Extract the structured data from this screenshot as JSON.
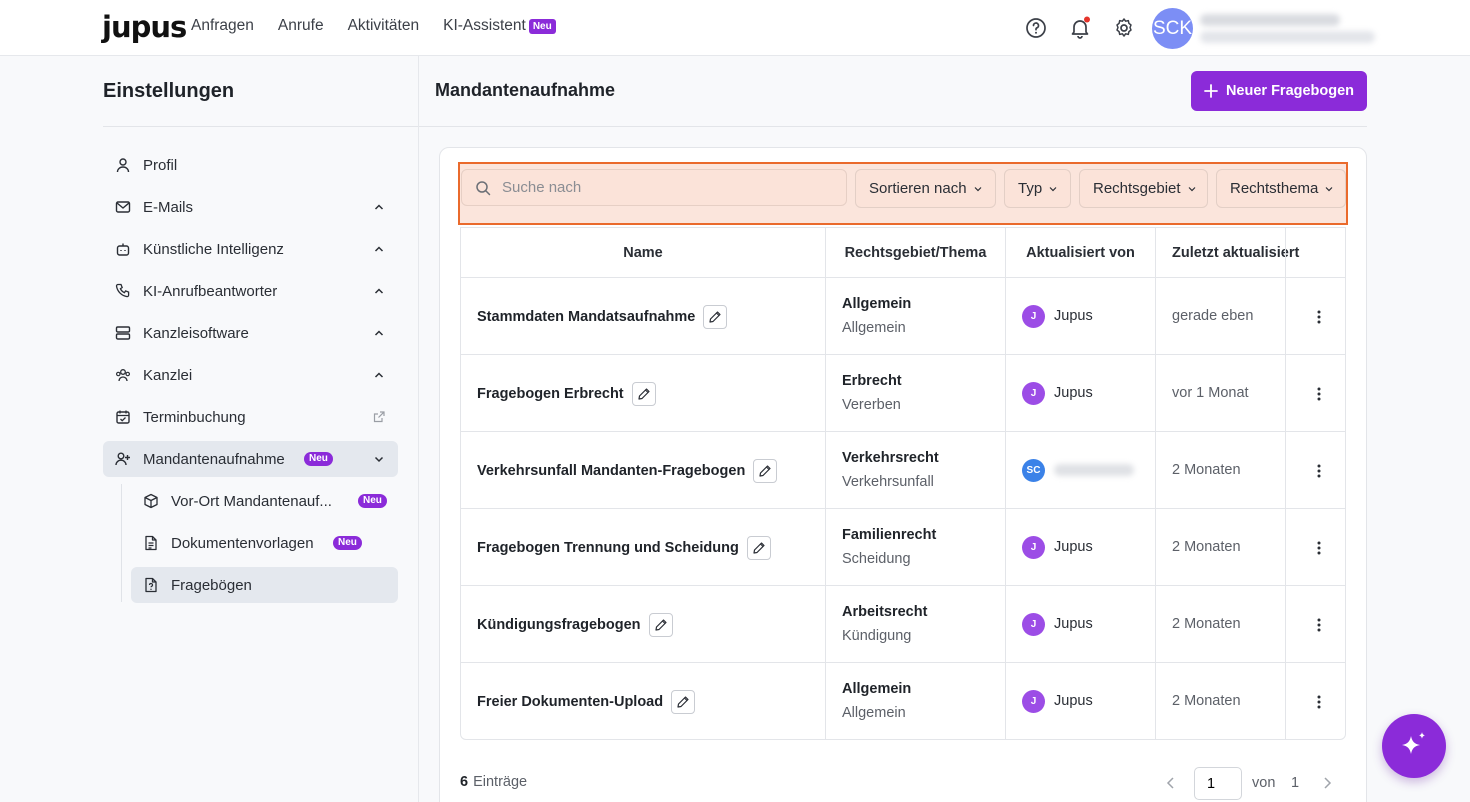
{
  "app": {
    "logo": "jupus",
    "nav": [
      {
        "label": "Anfragen"
      },
      {
        "label": "Anrufe"
      },
      {
        "label": "Aktivitäten"
      },
      {
        "label": "KI-Assistent",
        "badge": "Neu"
      }
    ],
    "user_initials": "SCK",
    "accent_color": "#8b2bd9"
  },
  "sidebar": {
    "title": "Einstellungen",
    "items": [
      {
        "label": "Profil",
        "icon": "user-icon"
      },
      {
        "label": "E-Mails",
        "icon": "mail-icon"
      },
      {
        "label": "Künstliche Intelligenz",
        "icon": "bot-icon"
      },
      {
        "label": "KI-Anrufbeantworter",
        "icon": "phone-icon"
      },
      {
        "label": "Kanzleisoftware",
        "icon": "server-icon"
      },
      {
        "label": "Kanzlei",
        "icon": "users-icon"
      },
      {
        "label": "Terminbuchung",
        "icon": "calendar-check-icon"
      },
      {
        "label": "Mandantenaufnahme",
        "icon": "user-plus-icon",
        "badge": "Neu"
      }
    ],
    "subitems": [
      {
        "label": "Vor-Ort Mandantenauf...",
        "icon": "package-icon",
        "badge": "Neu"
      },
      {
        "label": "Dokumentenvorlagen",
        "icon": "file-text-icon",
        "badge": "Neu"
      },
      {
        "label": "Fragebögen",
        "icon": "file-question-icon"
      }
    ]
  },
  "main": {
    "title": "Mandantenaufnahme",
    "new_button": "Neuer Fragebogen",
    "search": {
      "placeholder": "Suche nach"
    },
    "filters": [
      {
        "label": "Sortieren nach"
      },
      {
        "label": "Typ"
      },
      {
        "label": "Rechtsgebiet"
      },
      {
        "label": "Rechtsthema"
      }
    ],
    "table": {
      "headers": [
        "Name",
        "Rechtsgebiet/Thema",
        "Aktualisiert von",
        "Zuletzt aktualisiert"
      ],
      "rows": [
        {
          "name": "Stammdaten Mandatsaufnahme",
          "area": "Allgemein",
          "topic": "Allgemein",
          "user_initial": "J",
          "user": "Jupus",
          "updated": "gerade eben"
        },
        {
          "name": "Fragebogen Erbrecht",
          "area": "Erbrecht",
          "topic": "Vererben",
          "user_initial": "J",
          "user": "Jupus",
          "updated": "vor 1 Monat"
        },
        {
          "name": "Verkehrsunfall Mandanten-Fragebogen",
          "area": "Verkehrsrecht",
          "topic": "Verkehrsunfall",
          "user_initial": "SC",
          "user": "",
          "updated": "2 Monaten"
        },
        {
          "name": "Fragebogen Trennung und Scheidung",
          "area": "Familienrecht",
          "topic": "Scheidung",
          "user_initial": "J",
          "user": "Jupus",
          "updated": "2 Monaten"
        },
        {
          "name": "Kündigungsfragebogen",
          "area": "Arbeitsrecht",
          "topic": "Kündigung",
          "user_initial": "J",
          "user": "Jupus",
          "updated": "2 Monaten"
        },
        {
          "name": "Freier Dokumenten-Upload",
          "area": "Allgemein",
          "topic": "Allgemein",
          "user_initial": "J",
          "user": "Jupus",
          "updated": "2 Monaten"
        }
      ]
    },
    "footer": {
      "count": "6",
      "count_label": "Einträge",
      "page": "1",
      "of_label": "von",
      "total_pages": "1"
    }
  }
}
